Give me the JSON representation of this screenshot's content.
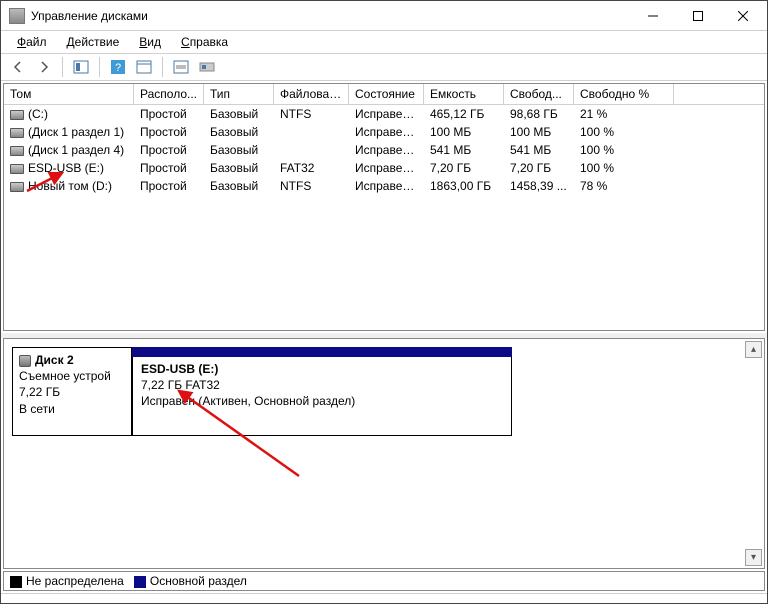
{
  "window": {
    "title": "Управление дисками"
  },
  "menu": {
    "file": "Файл",
    "action": "Действие",
    "view": "Вид",
    "help": "Справка"
  },
  "columns": {
    "c0": "Том",
    "c1": "Располо...",
    "c2": "Тип",
    "c3": "Файловая с...",
    "c4": "Состояние",
    "c5": "Емкость",
    "c6": "Свобод...",
    "c7": "Свободно %"
  },
  "volumes": [
    {
      "name": "(C:)",
      "layout": "Простой",
      "type": "Базовый",
      "fs": "NTFS",
      "status": "Исправен...",
      "cap": "465,12 ГБ",
      "free": "98,68 ГБ",
      "pct": "21 %"
    },
    {
      "name": "(Диск 1 раздел 1)",
      "layout": "Простой",
      "type": "Базовый",
      "fs": "",
      "status": "Исправен...",
      "cap": "100 МБ",
      "free": "100 МБ",
      "pct": "100 %"
    },
    {
      "name": "(Диск 1 раздел 4)",
      "layout": "Простой",
      "type": "Базовый",
      "fs": "",
      "status": "Исправен...",
      "cap": "541 МБ",
      "free": "541 МБ",
      "pct": "100 %"
    },
    {
      "name": "ESD-USB (E:)",
      "layout": "Простой",
      "type": "Базовый",
      "fs": "FAT32",
      "status": "Исправен...",
      "cap": "7,20 ГБ",
      "free": "7,20 ГБ",
      "pct": "100 %"
    },
    {
      "name": "Новый том (D:)",
      "layout": "Простой",
      "type": "Базовый",
      "fs": "NTFS",
      "status": "Исправен...",
      "cap": "1863,00 ГБ",
      "free": "1458,39 ...",
      "pct": "78 %"
    }
  ],
  "disk": {
    "label": "Диск 2",
    "kind": "Съемное устрой",
    "size": "7,22 ГБ",
    "state": "В сети",
    "part_name": "ESD-USB  (E:)",
    "part_info": "7,22 ГБ FAT32",
    "part_status": "Исправен (Активен, Основной раздел)"
  },
  "legend": {
    "unalloc": "Не распределена",
    "primary": "Основной раздел"
  }
}
